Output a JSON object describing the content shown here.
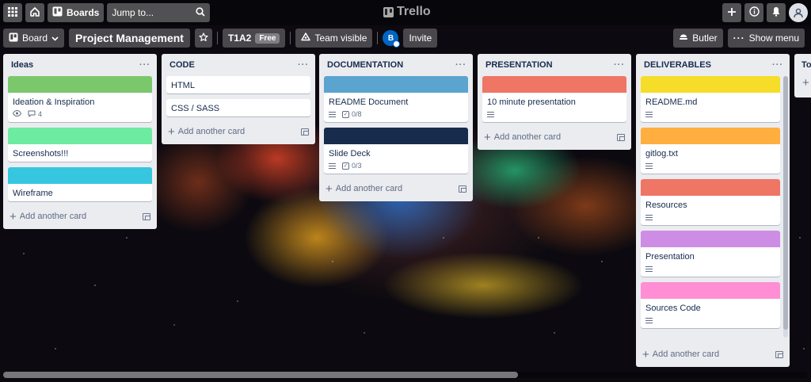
{
  "topbar": {
    "boards_label": "Boards",
    "search_placeholder": "Jump to...",
    "logo_text": "Trello",
    "icons": [
      "apps-grid-icon",
      "home-icon",
      "boards-icon",
      "search-icon",
      "plus-icon",
      "info-icon",
      "bell-icon",
      "user-avatar-icon"
    ]
  },
  "boardbar": {
    "view_label": "Board",
    "board_title": "Project Management",
    "workspace": "T1A2",
    "plan_badge": "Free",
    "visibility": "Team visible",
    "member_initial": "B",
    "invite_label": "Invite",
    "butler_label": "Butler",
    "menu_label": "Show menu"
  },
  "colors": {
    "green": "#7bc86c",
    "lightgreen": "#6deba0",
    "teal": "#37c6e0",
    "blue": "#5ba4cf",
    "navy": "#172b4d",
    "red": "#ef7564",
    "yellow": "#f5dd29",
    "orange": "#ffaf3f",
    "purple": "#cd8de5",
    "pink": "#ff8ed4"
  },
  "add_card_label": "Add another card",
  "lists": [
    {
      "title": "Ideas",
      "cards": [
        {
          "title": "Ideation & Inspiration",
          "cover": "#7bc86c",
          "watch": true,
          "comments": "4"
        },
        {
          "title": "Screenshots!!!",
          "cover": "#6deba0"
        },
        {
          "title": "Wireframe",
          "cover": "#37c6e0"
        }
      ]
    },
    {
      "title": "CODE",
      "cards": [
        {
          "title": "HTML"
        },
        {
          "title": "CSS / SASS"
        }
      ]
    },
    {
      "title": "DOCUMENTATION",
      "cards": [
        {
          "title": "README Document",
          "cover": "#5ba4cf",
          "desc": true,
          "checklist": "0/8"
        },
        {
          "title": "Slide Deck",
          "cover": "#172b4d",
          "desc": true,
          "checklist": "0/3"
        }
      ]
    },
    {
      "title": "PRESENTATION",
      "cards": [
        {
          "title": "10 minute presentation",
          "cover": "#ef7564",
          "desc": true
        }
      ]
    },
    {
      "title": "DELIVERABLES",
      "cards": [
        {
          "title": "README.md",
          "cover": "#f5dd29",
          "desc": true
        },
        {
          "title": "gitlog.txt",
          "cover": "#ffaf3f",
          "desc": true
        },
        {
          "title": "Resources",
          "cover": "#ef7564",
          "desc": true
        },
        {
          "title": "Presentation",
          "cover": "#cd8de5",
          "desc": true
        },
        {
          "title": "Sources Code",
          "cover": "#ff8ed4",
          "desc": true
        }
      ]
    },
    {
      "title": "To"
    }
  ]
}
